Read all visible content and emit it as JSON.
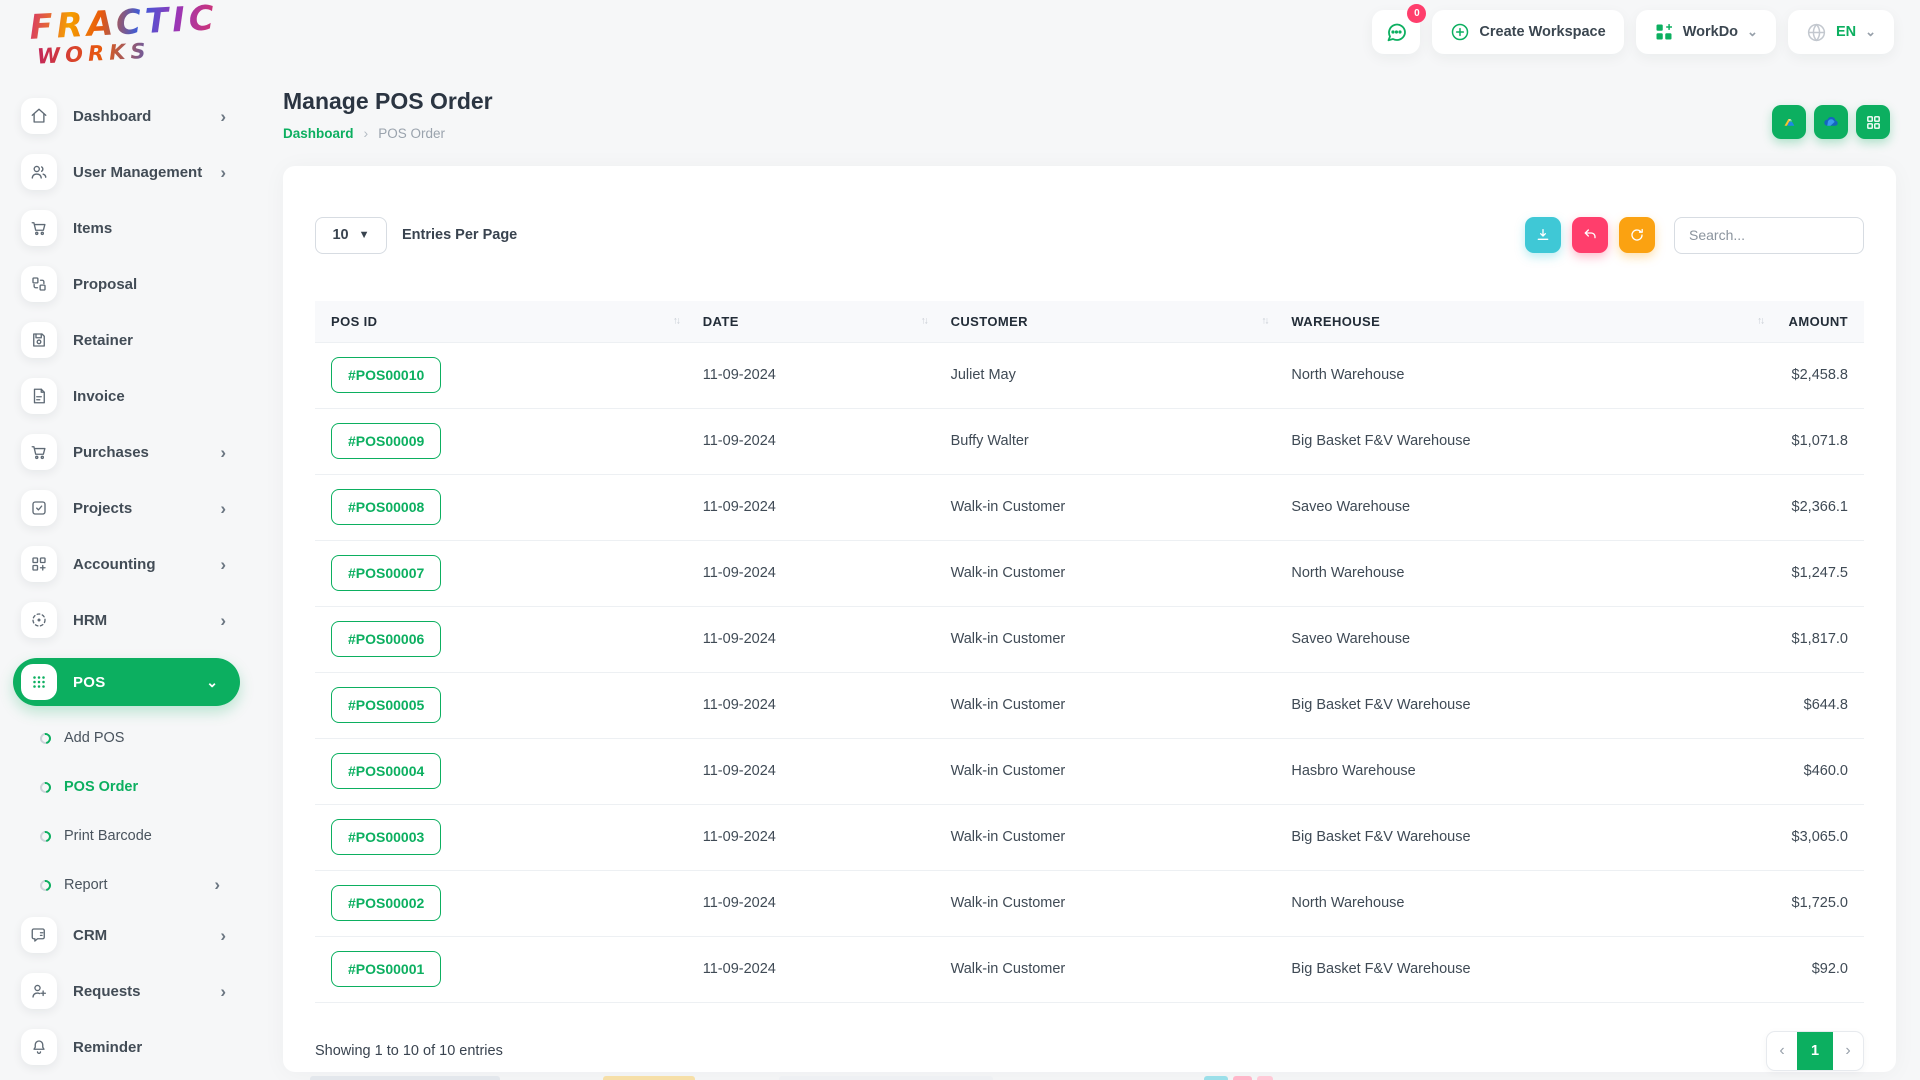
{
  "brand": {
    "line1": "FRACTIC",
    "line2": "WORKS"
  },
  "topbar": {
    "messages_badge": "0",
    "create_workspace_label": "Create Workspace",
    "workspace_name": "WorkDo",
    "language_code": "EN"
  },
  "sidebar": {
    "items": [
      {
        "label": "Dashboard"
      },
      {
        "label": "User Management"
      },
      {
        "label": "Items"
      },
      {
        "label": "Proposal"
      },
      {
        "label": "Retainer"
      },
      {
        "label": "Invoice"
      },
      {
        "label": "Purchases"
      },
      {
        "label": "Projects"
      },
      {
        "label": "Accounting"
      },
      {
        "label": "HRM"
      },
      {
        "label": "POS"
      }
    ],
    "pos_submenu": [
      {
        "label": "Add POS"
      },
      {
        "label": "POS Order"
      },
      {
        "label": "Print Barcode"
      },
      {
        "label": "Report"
      }
    ],
    "bottom_items": [
      {
        "label": "CRM"
      },
      {
        "label": "Requests"
      },
      {
        "label": "Reminder"
      }
    ]
  },
  "page": {
    "title": "Manage POS Order",
    "breadcrumb_home": "Dashboard",
    "breadcrumb_current": "POS Order"
  },
  "toolbar": {
    "entries_per_page_value": "10",
    "entries_per_page_label": "Entries Per Page",
    "search_placeholder": "Search..."
  },
  "table": {
    "columns": [
      "POS ID",
      "DATE",
      "CUSTOMER",
      "WAREHOUSE",
      "AMOUNT"
    ],
    "rows": [
      {
        "pos_id": "#POS00010",
        "date": "11-09-2024",
        "customer": "Juliet May",
        "warehouse": "North Warehouse",
        "amount": "$2,458.8"
      },
      {
        "pos_id": "#POS00009",
        "date": "11-09-2024",
        "customer": "Buffy Walter",
        "warehouse": "Big Basket F&V Warehouse",
        "amount": "$1,071.8"
      },
      {
        "pos_id": "#POS00008",
        "date": "11-09-2024",
        "customer": "Walk-in Customer",
        "warehouse": "Saveo Warehouse",
        "amount": "$2,366.1"
      },
      {
        "pos_id": "#POS00007",
        "date": "11-09-2024",
        "customer": "Walk-in Customer",
        "warehouse": "North Warehouse",
        "amount": "$1,247.5"
      },
      {
        "pos_id": "#POS00006",
        "date": "11-09-2024",
        "customer": "Walk-in Customer",
        "warehouse": "Saveo Warehouse",
        "amount": "$1,817.0"
      },
      {
        "pos_id": "#POS00005",
        "date": "11-09-2024",
        "customer": "Walk-in Customer",
        "warehouse": "Big Basket F&V Warehouse",
        "amount": "$644.8"
      },
      {
        "pos_id": "#POS00004",
        "date": "11-09-2024",
        "customer": "Walk-in Customer",
        "warehouse": "Hasbro Warehouse",
        "amount": "$460.0"
      },
      {
        "pos_id": "#POS00003",
        "date": "11-09-2024",
        "customer": "Walk-in Customer",
        "warehouse": "Big Basket F&V Warehouse",
        "amount": "$3,065.0"
      },
      {
        "pos_id": "#POS00002",
        "date": "11-09-2024",
        "customer": "Walk-in Customer",
        "warehouse": "North Warehouse",
        "amount": "$1,725.0"
      },
      {
        "pos_id": "#POS00001",
        "date": "11-09-2024",
        "customer": "Walk-in Customer",
        "warehouse": "Big Basket F&V Warehouse",
        "amount": "$92.0"
      }
    ],
    "summary": "Showing 1 to 10 of 10 entries"
  },
  "pagination": {
    "current_page": "1"
  },
  "colors": {
    "primary_green": "#0caf60",
    "badge_pink": "#ff3e6c",
    "export_teal": "#3fc8d6",
    "undo_pink": "#ff3e6c",
    "refresh_orange": "#fba211"
  }
}
